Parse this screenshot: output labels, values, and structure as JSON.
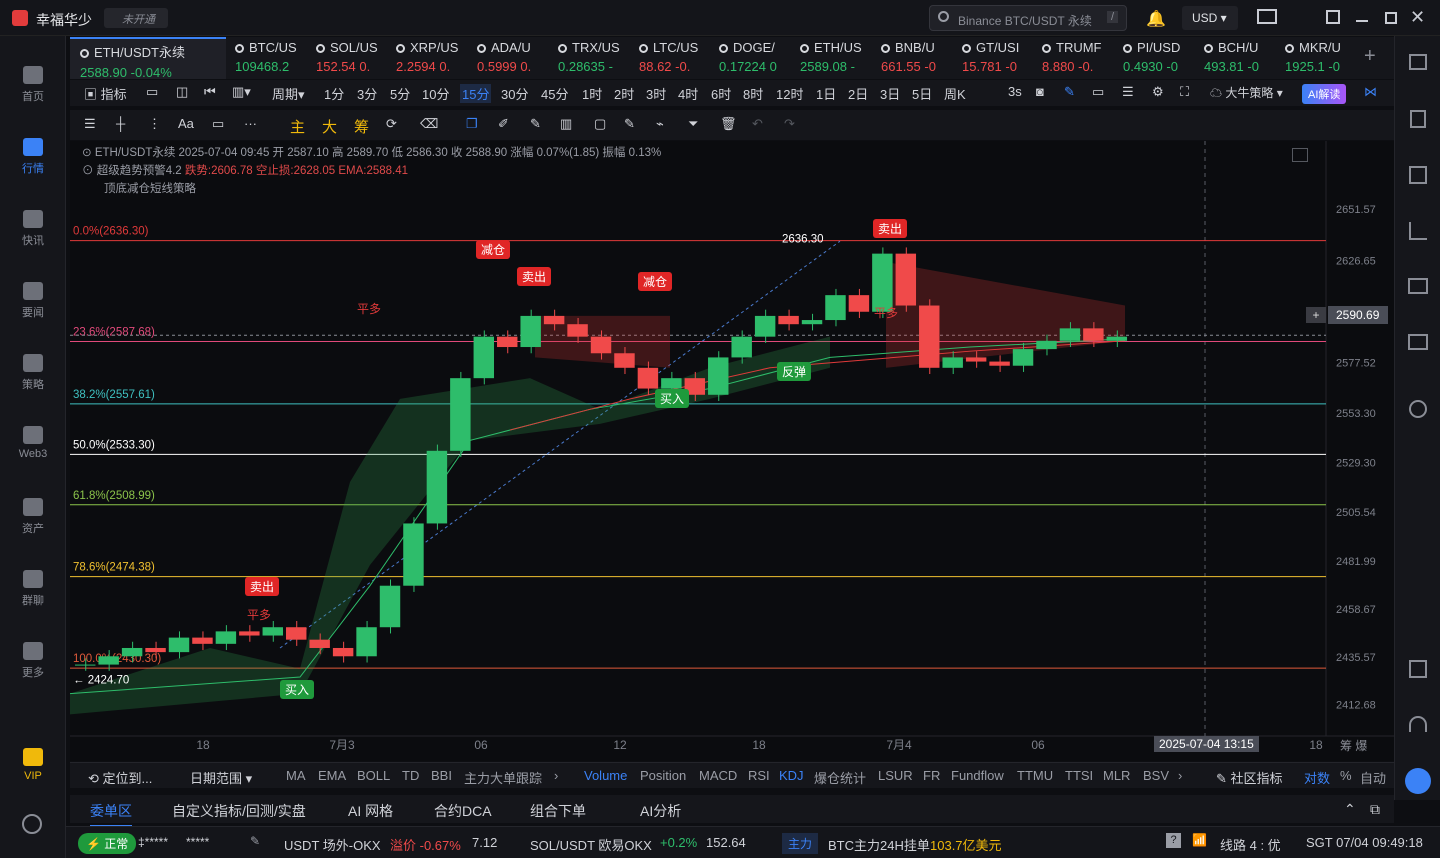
{
  "app": {
    "name": "幸福华少",
    "badge": "未开通",
    "search_placeholder": "Binance BTC/USDT 永续",
    "search_key": "/",
    "currency": "USD"
  },
  "nav": [
    "首页",
    "行情",
    "快讯",
    "要闻",
    "策略",
    "Web3",
    "资产",
    "群聊",
    "更多",
    "VIP"
  ],
  "tickers": [
    {
      "name": "ETH/USDT永续",
      "price": "2588.90",
      "chg": "-0.04%"
    },
    {
      "name": "BTC/US",
      "price": "109468.2",
      "chg": ""
    },
    {
      "name": "SOL/US",
      "price": "152.54",
      "chg": "0."
    },
    {
      "name": "XRP/US",
      "price": "2.2594",
      "chg": "0."
    },
    {
      "name": "ADA/U",
      "price": "0.5999",
      "chg": "0."
    },
    {
      "name": "TRX/US",
      "price": "0.28635",
      "chg": "-"
    },
    {
      "name": "LTC/US",
      "price": "88.62",
      "chg": "-0."
    },
    {
      "name": "DOGE/",
      "price": "0.17224",
      "chg": "0"
    },
    {
      "name": "ETH/US",
      "price": "2589.08",
      "chg": "-"
    },
    {
      "name": "BNB/U",
      "price": "661.55",
      "chg": "-0"
    },
    {
      "name": "GT/USI",
      "price": "15.781",
      "chg": "-0"
    },
    {
      "name": "TRUMF",
      "price": "8.880",
      "chg": "-0."
    },
    {
      "name": "PI/USD",
      "price": "0.4930",
      "chg": "-0"
    },
    {
      "name": "BCH/U",
      "price": "493.81",
      "chg": "-0"
    },
    {
      "name": "MKR/U",
      "price": "1925.1",
      "chg": "-0"
    }
  ],
  "toolbar": {
    "indicator": "指标",
    "period": "周期",
    "periods": [
      "1分",
      "3分",
      "5分",
      "10分",
      "15分",
      "30分",
      "45分",
      "1时",
      "2时",
      "3时",
      "4时",
      "6时",
      "8时",
      "12时",
      "1日",
      "2日",
      "3日",
      "5日",
      "周K"
    ],
    "refresh": "3s",
    "strategy": "大牛策略",
    "ai": "AI解读"
  },
  "drawtools": [
    "主",
    "大",
    "筹"
  ],
  "info": {
    "line1": "ETH/USDT永续 2025-07-04 09:45 开 2587.10 高 2589.70 低 2586.30 收 2588.90 涨幅 0.07%(1.85) 振幅 0.13%",
    "l2a": "超级趋势预警4.2",
    "l2b": "跌势:2606.78",
    "l2c": "空止损:2628.05",
    "l2d": "EMA:2588.41",
    "line3": "顶底减仓短线策略"
  },
  "chart_data": {
    "type": "candlestick",
    "symbol": "ETH/USDT永续",
    "ylim": [
      2400,
      2665
    ],
    "y_ticks": [
      "2651.57",
      "2626.65",
      "2601.97",
      "2577.52",
      "2553.30",
      "2529.30",
      "2505.54",
      "2481.99",
      "2458.67",
      "2435.57",
      "2412.68"
    ],
    "x_ticks": [
      "18",
      "7月3",
      "06",
      "12",
      "18",
      "7月4",
      "06",
      "18"
    ],
    "current_price": "2590.69",
    "crosshair_time": "2025-07-04 13:15",
    "fib_levels": [
      {
        "label": "0.0%(2636.30)",
        "value": 2636.3,
        "color": "#e03a3a"
      },
      {
        "label": "23.6%(2587.68)",
        "value": 2587.68,
        "color": "#e04a7a"
      },
      {
        "label": "38.2%(2557.61)",
        "value": 2557.61,
        "color": "#3fc0c0"
      },
      {
        "label": "50.0%(2533.30)",
        "value": 2533.3,
        "color": "#ffffff"
      },
      {
        "label": "61.8%(2508.99)",
        "value": 2508.99,
        "color": "#8bc34a"
      },
      {
        "label": "78.6%(2474.38)",
        "value": 2474.38,
        "color": "#f0c030"
      },
      {
        "label": "100.0%(2430.30)",
        "value": 2430.3,
        "color": "#e05a3a"
      }
    ],
    "high_label": "2636.30",
    "low_label": "← 2424.70",
    "signals": [
      "卖出",
      "减仓",
      "卖出",
      "减仓",
      "卖出",
      "平多",
      "平多",
      "平多",
      "买入",
      "买入",
      "反弹",
      "卖出"
    ],
    "close_path": [
      2432,
      2436,
      2440,
      2438,
      2445,
      2442,
      2448,
      2446,
      2450,
      2444,
      2440,
      2436,
      2450,
      2470,
      2500,
      2535,
      2570,
      2590,
      2585,
      2600,
      2596,
      2590,
      2582,
      2575,
      2565,
      2570,
      2562,
      2580,
      2590,
      2600,
      2596,
      2598,
      2610,
      2602,
      2630,
      2605,
      2575,
      2580,
      2578,
      2576,
      2584,
      2588,
      2594,
      2588,
      2590
    ]
  },
  "indicator_bar": {
    "left": "定位到...",
    "range": "日期范围",
    "items": [
      "MA",
      "EMA",
      "BOLL",
      "TD",
      "BBI",
      "主力大单跟踪",
      "Volume",
      "Position",
      "MACD",
      "RSI",
      "KDJ",
      "爆仓统计",
      "LSUR",
      "FR",
      "Fundflow",
      "TTMU",
      "TTSI",
      "MLR",
      "BSV"
    ],
    "community": "社区指标",
    "pair": "对数",
    "pct": "%",
    "auto": "自动"
  },
  "bottom_tabs": [
    "委单区",
    "自定义指标/回测/实盘",
    "AI 网格",
    "合约DCA",
    "组合下单",
    "AI分析"
  ],
  "status": {
    "state": "正常",
    "user": "‡*****",
    "pwd": "*****",
    "item1": "USDT 场外-OKX",
    "premium": "溢价 -0.67%",
    "val1": "7.12",
    "item2": "SOL/USDT 欧易OKX",
    "chg2": "+0.2%",
    "val2": "152.64",
    "tag": "主力",
    "item3": "BTC主力24H挂单",
    "val3": "103.7亿美元",
    "line": "线路 4 : 优",
    "time": "SGT 07/04 09:49:18"
  }
}
